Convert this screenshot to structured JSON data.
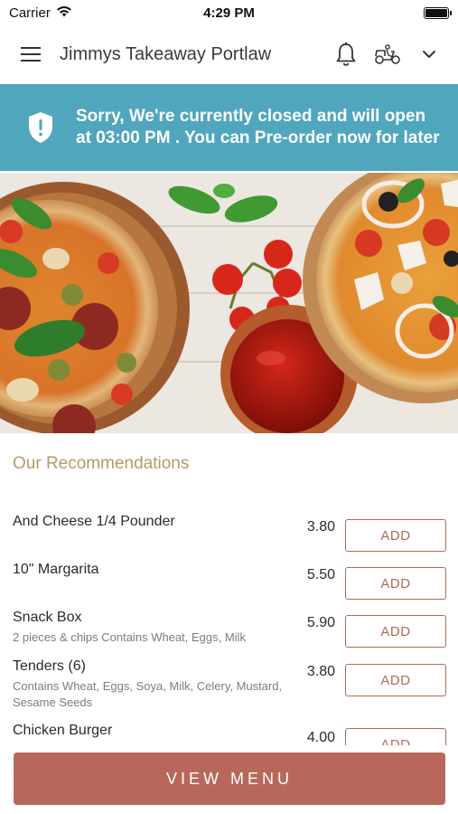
{
  "status_bar": {
    "carrier": "Carrier",
    "time": "4:29 PM"
  },
  "header": {
    "title": "Jimmys Takeaway Portlaw"
  },
  "banner": {
    "message": "Sorry, We're currently closed and will open at 03:00 PM . You can Pre-order now for later"
  },
  "recommendations": {
    "title": "Our Recommendations",
    "items": [
      {
        "name": "And Cheese 1/4 Pounder",
        "description": "",
        "price": "3.80",
        "button": "ADD"
      },
      {
        "name": "10\" Margarita",
        "description": "",
        "price": "5.50",
        "button": "ADD"
      },
      {
        "name": "Snack Box",
        "description": "2 pieces & chips Contains Wheat, Eggs, Milk",
        "price": "5.90",
        "button": "ADD"
      },
      {
        "name": "Tenders (6)",
        "description": "Contains Wheat, Eggs, Soya, Milk, Celery, Mustard, Sesame Seeds",
        "price": "3.80",
        "button": "ADD"
      },
      {
        "name": "Chicken Burger",
        "description": "",
        "price": "4.00",
        "button": "ADD"
      }
    ]
  },
  "footer": {
    "view_menu": "VIEW MENU"
  },
  "colors": {
    "banner": "#4fa6bd",
    "accent": "#b8685a",
    "section_title": "#b49b67"
  },
  "icons": [
    "wifi-icon",
    "battery-icon",
    "hamburger-menu-icon",
    "bell-icon",
    "scooter-icon",
    "chevron-down-icon",
    "shield-alert-icon"
  ]
}
